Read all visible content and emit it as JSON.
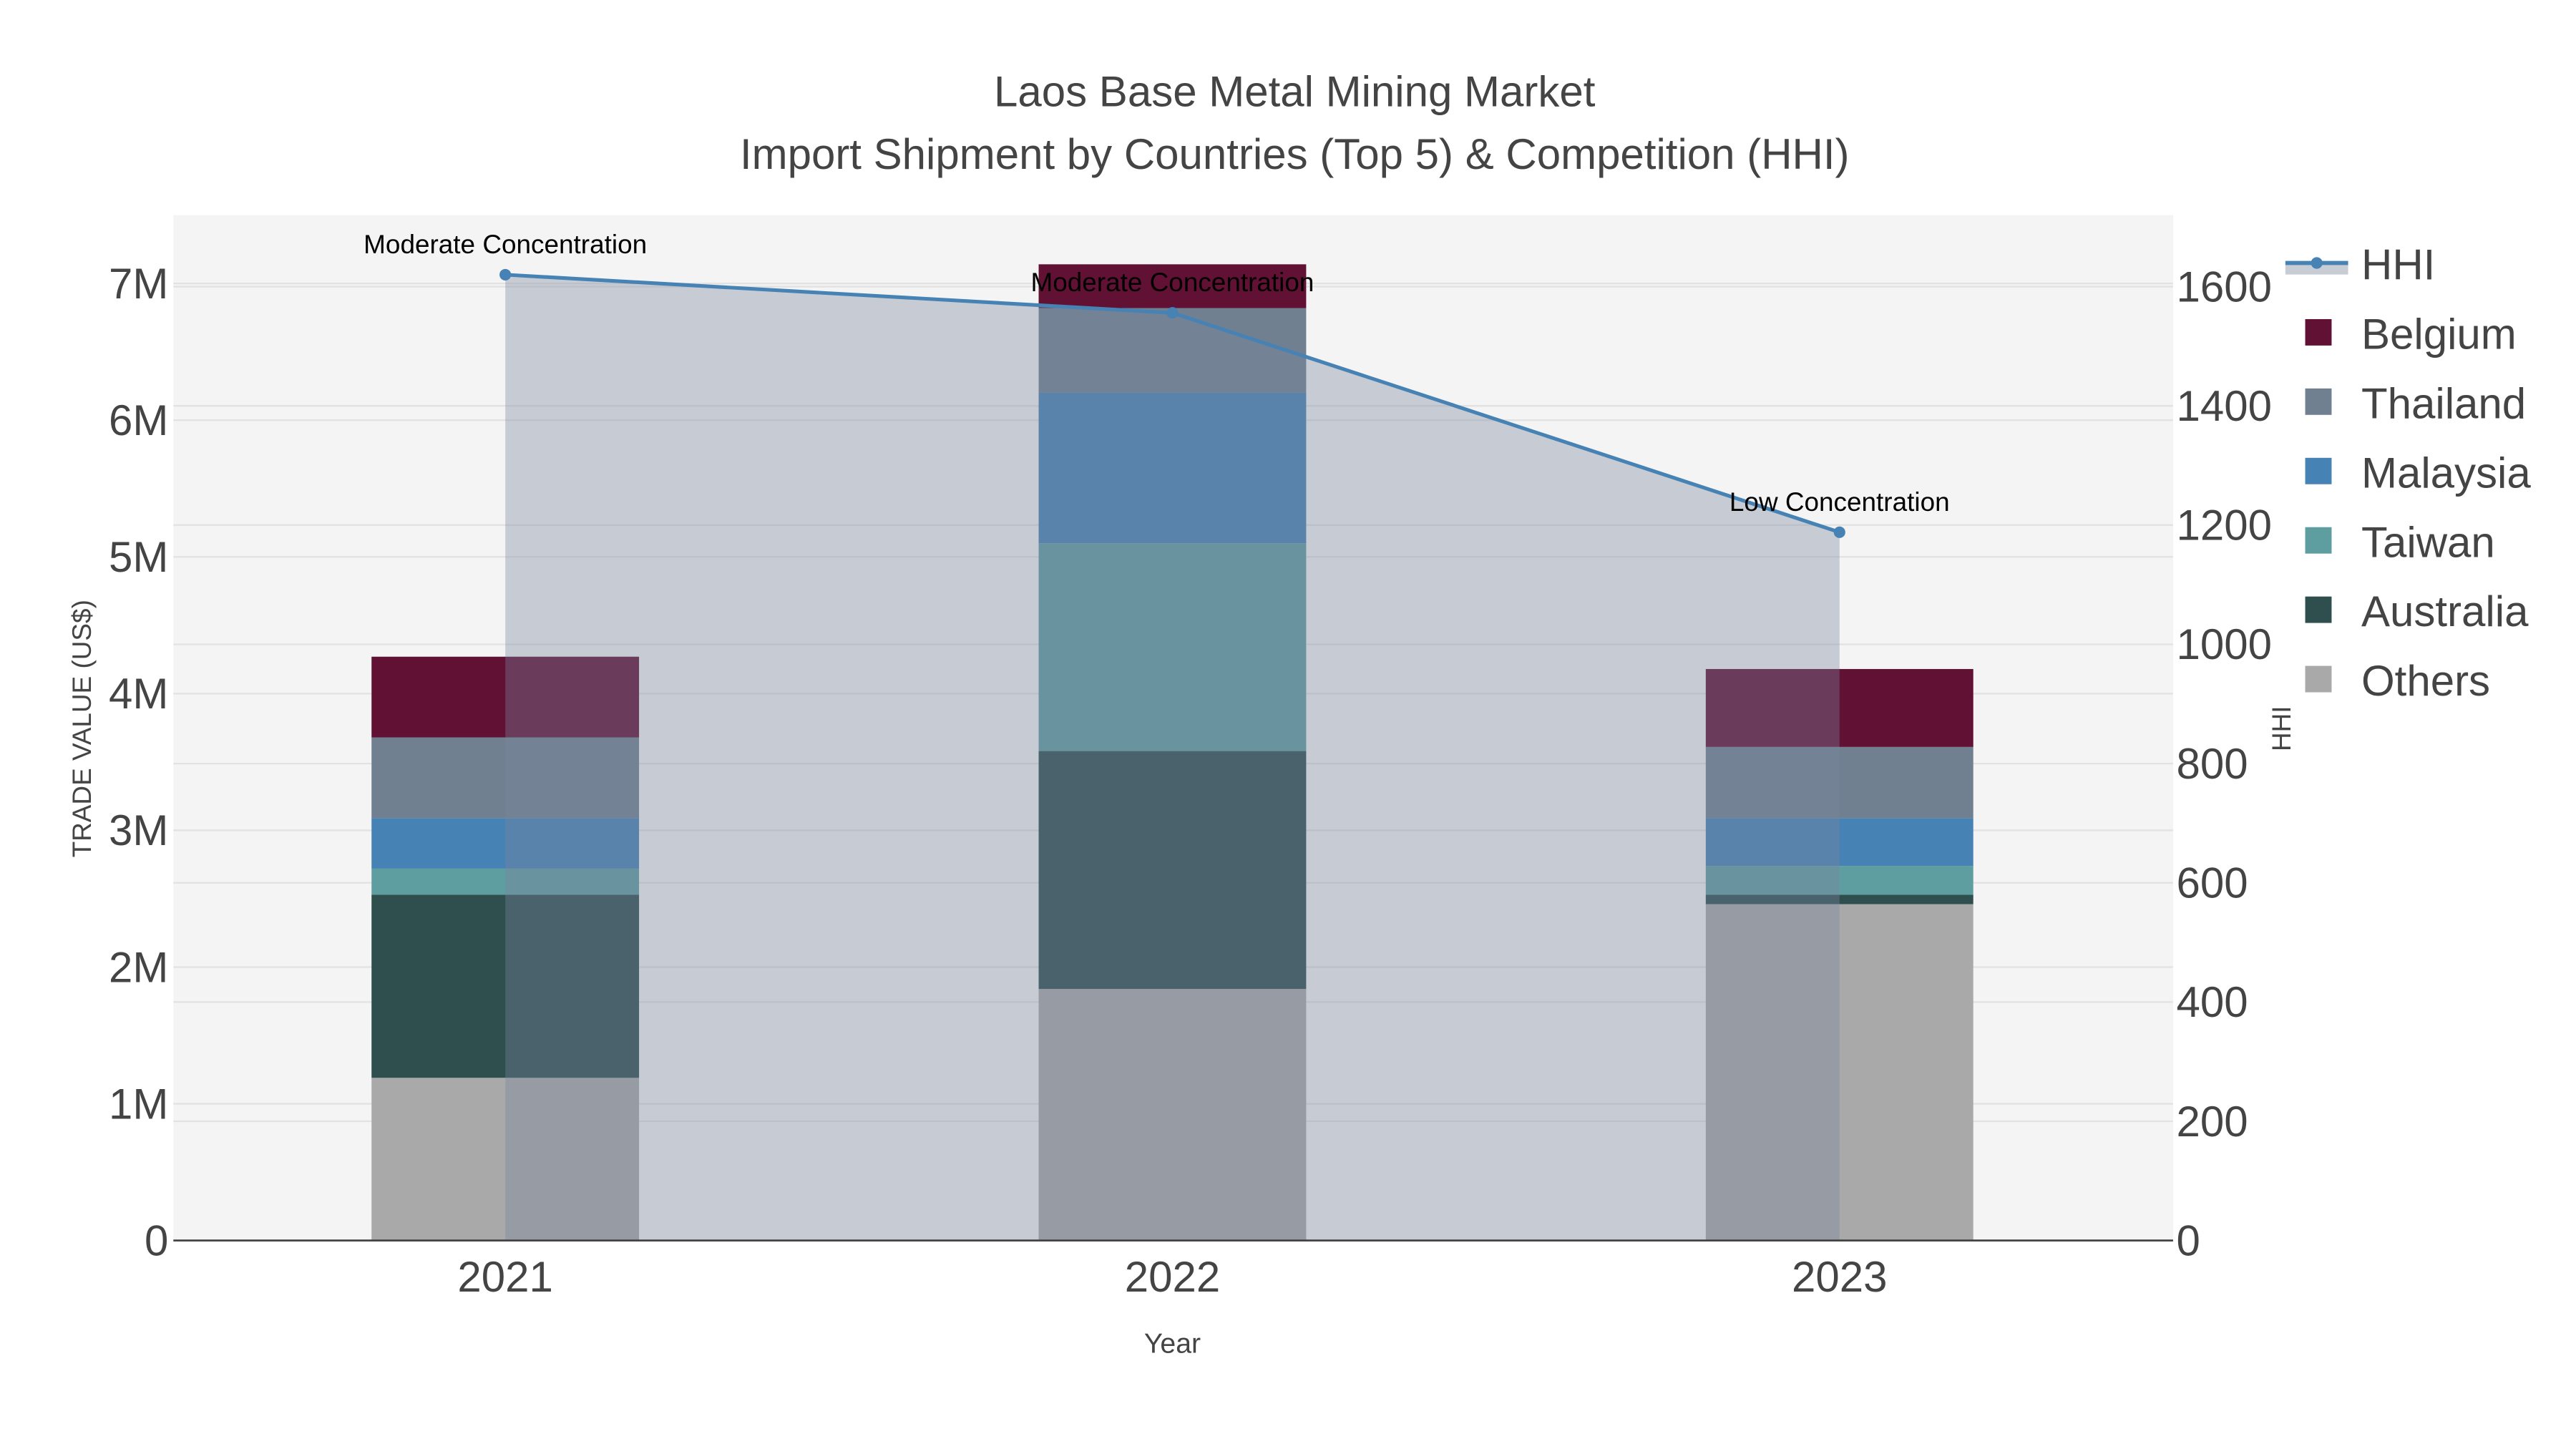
{
  "chart_data": {
    "type": "bar",
    "barmode": "stack",
    "title": "Laos Base Metal Mining Market",
    "subtitle": "Import Shipment by Countries (Top 5) & Competition (HHI)",
    "xlabel": "Year",
    "ylabel": "TRADE VALUE (US$)",
    "y2label": "HHI",
    "categories": [
      "2021",
      "2022",
      "2023"
    ],
    "ylim": [
      0,
      7500000
    ],
    "y2lim": [
      0,
      1720
    ],
    "yticks": [
      0,
      1000000,
      2000000,
      3000000,
      4000000,
      5000000,
      6000000,
      7000000
    ],
    "ytick_labels": [
      "0",
      "1M",
      "2M",
      "3M",
      "4M",
      "5M",
      "6M",
      "7M"
    ],
    "y2ticks": [
      0,
      200,
      400,
      600,
      800,
      1000,
      1200,
      1400,
      1600
    ],
    "y2tick_labels": [
      "0",
      "200",
      "400",
      "600",
      "800",
      "1000",
      "1200",
      "1400",
      "1600"
    ],
    "grid": true,
    "legend_position": "right",
    "series": [
      {
        "name": "Others",
        "color": "#a9a9a9",
        "values": [
          1190000,
          1840000,
          2460000
        ]
      },
      {
        "name": "Australia",
        "color": "#2f4f4f",
        "values": [
          1340000,
          1740000,
          70000
        ]
      },
      {
        "name": "Taiwan",
        "color": "#5f9ea0",
        "values": [
          190000,
          1520000,
          210000
        ]
      },
      {
        "name": "Malaysia",
        "color": "#4682b4",
        "values": [
          370000,
          1100000,
          350000
        ]
      },
      {
        "name": "Thailand",
        "color": "#708090",
        "values": [
          590000,
          620000,
          520000
        ]
      },
      {
        "name": "Belgium",
        "color": "#611134",
        "values": [
          590000,
          320000,
          570000
        ]
      }
    ],
    "hhi": {
      "name": "HHI",
      "color": "#4682b4",
      "values": [
        1620,
        1556,
        1188
      ],
      "annotations": [
        "Moderate Concentration",
        "Moderate Concentration",
        "Low Concentration"
      ]
    },
    "legend_order": [
      "HHI",
      "Belgium",
      "Thailand",
      "Malaysia",
      "Taiwan",
      "Australia",
      "Others"
    ]
  }
}
